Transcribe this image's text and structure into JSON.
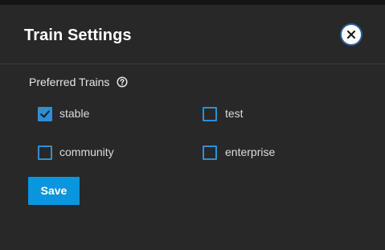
{
  "dialog": {
    "title": "Train Settings",
    "close_icon": "close-circle-icon"
  },
  "preferred_trains": {
    "label": "Preferred Trains",
    "help_icon": "help-circle-icon",
    "options": [
      {
        "label": "stable",
        "checked": true
      },
      {
        "label": "test",
        "checked": false
      },
      {
        "label": "community",
        "checked": false
      },
      {
        "label": "enterprise",
        "checked": false
      }
    ]
  },
  "actions": {
    "save_label": "Save"
  },
  "colors": {
    "accent": "#0b95dd",
    "checkbox": "#2e8fd6",
    "dialog_bg": "#282828"
  }
}
